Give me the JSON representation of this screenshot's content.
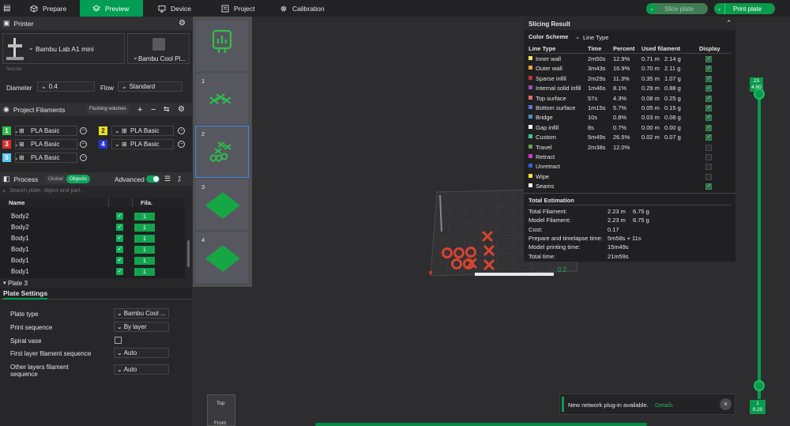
{
  "tabs": [
    {
      "label": "Prepare",
      "icon": "cube-icon"
    },
    {
      "label": "Preview",
      "icon": "layers-icon"
    },
    {
      "label": "Device",
      "icon": "monitor-icon"
    },
    {
      "label": "Project",
      "icon": "project-icon"
    },
    {
      "label": "Calibration",
      "icon": "gear-icon"
    }
  ],
  "actions": {
    "slice_plate": "Slice plate",
    "print_plate": "Print plate"
  },
  "printer": {
    "section_title": "Printer",
    "model": "Bambu Lab A1 mini",
    "plate": "Bambu Cool Pl...",
    "nozzle_label": "Nozzle",
    "diameter_label": "Diameter",
    "diameter_value": "0.4",
    "flow_label": "Flow",
    "flow_value": "Standard"
  },
  "filaments": {
    "section_title": "Project Filaments",
    "flushing_label": "Flushing volumes",
    "items": [
      {
        "num": "1",
        "name": "PLA Basic",
        "color": "#2fbf4a"
      },
      {
        "num": "2",
        "name": "PLA Basic",
        "color": "#e8df24"
      },
      {
        "num": "3",
        "name": "PLA Basic",
        "color": "#d8322c"
      },
      {
        "num": "4",
        "name": "PLA Basic",
        "color": "#2b34d6"
      },
      {
        "num": "5",
        "name": "PLA Basic",
        "color": "#5bc8ef"
      }
    ]
  },
  "process": {
    "section_title": "Process",
    "global_label": "Global",
    "objects_label": "Objects",
    "advanced_label": "Advanced",
    "search_placeholder": "Search plate, object and part.",
    "col_name": "Name",
    "col_fila": "Fila.",
    "rows": [
      {
        "name": "Body2",
        "fila": "1"
      },
      {
        "name": "Body2",
        "fila": "1"
      },
      {
        "name": "Body1",
        "fila": "1"
      },
      {
        "name": "Body1",
        "fila": "1"
      },
      {
        "name": "Body1",
        "fila": "1"
      },
      {
        "name": "Body1",
        "fila": "1"
      }
    ],
    "plate_node": "Plate 3"
  },
  "plate_settings": {
    "title": "Plate Settings",
    "rows": [
      {
        "label": "Plate type",
        "value": "Bambu Cool ..."
      },
      {
        "label": "Print sequence",
        "value": "By layer"
      },
      {
        "label": "Spiral vase",
        "value": ""
      },
      {
        "label": "First layer filament sequence",
        "value": "Auto"
      },
      {
        "label": "Other layers filament sequence",
        "value": "Auto"
      }
    ]
  },
  "plates": [
    {
      "num": ""
    },
    {
      "num": "1"
    },
    {
      "num": "2"
    },
    {
      "num": "3"
    },
    {
      "num": "4"
    }
  ],
  "slicing": {
    "title": "Slicing Result",
    "color_scheme_label": "Color Scheme",
    "color_scheme_value": "Line Type",
    "headers": [
      "Line Type",
      "Time",
      "Percent",
      "Used filament",
      "Display"
    ],
    "rows": [
      {
        "type": "Inner wall",
        "color": "#f5e35a",
        "time": "2m50s",
        "percent": "12.9%",
        "len": "0.71 m",
        "weight": "2.14 g",
        "display": true
      },
      {
        "type": "Outer wall",
        "color": "#f0a23a",
        "time": "3m43s",
        "percent": "16.9%",
        "len": "0.70 m",
        "weight": "2.11 g",
        "display": true
      },
      {
        "type": "Sparse infill",
        "color": "#b3373f",
        "time": "2m29s",
        "percent": "11.3%",
        "len": "0.35 m",
        "weight": "1.07 g",
        "display": true
      },
      {
        "type": "Internal solid infill",
        "color": "#9d4ec0",
        "time": "1m46s",
        "percent": "8.1%",
        "len": "0.29 m",
        "weight": "0.88 g",
        "display": true
      },
      {
        "type": "Top surface",
        "color": "#e76a6a",
        "time": "57s",
        "percent": "4.3%",
        "len": "0.08 m",
        "weight": "0.25 g",
        "display": true
      },
      {
        "type": "Bottom surface",
        "color": "#6a6fd8",
        "time": "1m15s",
        "percent": "5.7%",
        "len": "0.05 m",
        "weight": "0.15 g",
        "display": true
      },
      {
        "type": "Bridge",
        "color": "#4f8fc9",
        "time": "10s",
        "percent": "0.8%",
        "len": "0.03 m",
        "weight": "0.08 g",
        "display": true
      },
      {
        "type": "Gap infill",
        "color": "#ffffff",
        "time": "8s",
        "percent": "0.7%",
        "len": "0.00 m",
        "weight": "0.00 g",
        "display": true
      },
      {
        "type": "Custom",
        "color": "#3cc98a",
        "time": "5m49s",
        "percent": "26.5%",
        "len": "0.02 m",
        "weight": "0.07 g",
        "display": true
      },
      {
        "type": "Travel",
        "color": "#6ea34a",
        "time": "2m38s",
        "percent": "12.0%",
        "len": "",
        "weight": "",
        "display": false
      },
      {
        "type": "Retract",
        "color": "#d13bd1",
        "time": "",
        "percent": "",
        "len": "",
        "weight": "",
        "display": false
      },
      {
        "type": "Unretract",
        "color": "#3a5fd8",
        "time": "",
        "percent": "",
        "len": "",
        "weight": "",
        "display": false
      },
      {
        "type": "Wipe",
        "color": "#f2e23a",
        "time": "",
        "percent": "",
        "len": "",
        "weight": "",
        "display": false
      },
      {
        "type": "Seams",
        "color": "#f0f0f0",
        "time": "",
        "percent": "",
        "len": "",
        "weight": "",
        "display": true
      }
    ],
    "estimation_title": "Total Estimation",
    "estimation": [
      {
        "label": "Total Filament:",
        "v1": "2.23 m",
        "v2": "6.75 g"
      },
      {
        "label": "Model Filament:",
        "v1": "2.23 m",
        "v2": "6.75 g"
      },
      {
        "label": "Cost:",
        "v1": "0.17",
        "v2": ""
      },
      {
        "label": "Prepare and timelapse time:",
        "v1": "5m58s + 11s",
        "v2": ""
      },
      {
        "label": "Model printing time:",
        "v1": "15m49s",
        "v2": ""
      },
      {
        "label": "Total time:",
        "v1": "21m59s",
        "v2": ""
      }
    ]
  },
  "layer_slider": {
    "top_layer": "23",
    "top_height": "4.60",
    "bottom_layer": "1",
    "bottom_height": "0.20"
  },
  "view_cube": {
    "top": "Top",
    "front": "Front"
  },
  "notification": {
    "text": "New network plug-in available.",
    "link": "Details"
  },
  "bed_label": "0.2",
  "colors": {
    "accent": "#009e54",
    "panel": "#272729",
    "viewport": "#2d2d30"
  }
}
